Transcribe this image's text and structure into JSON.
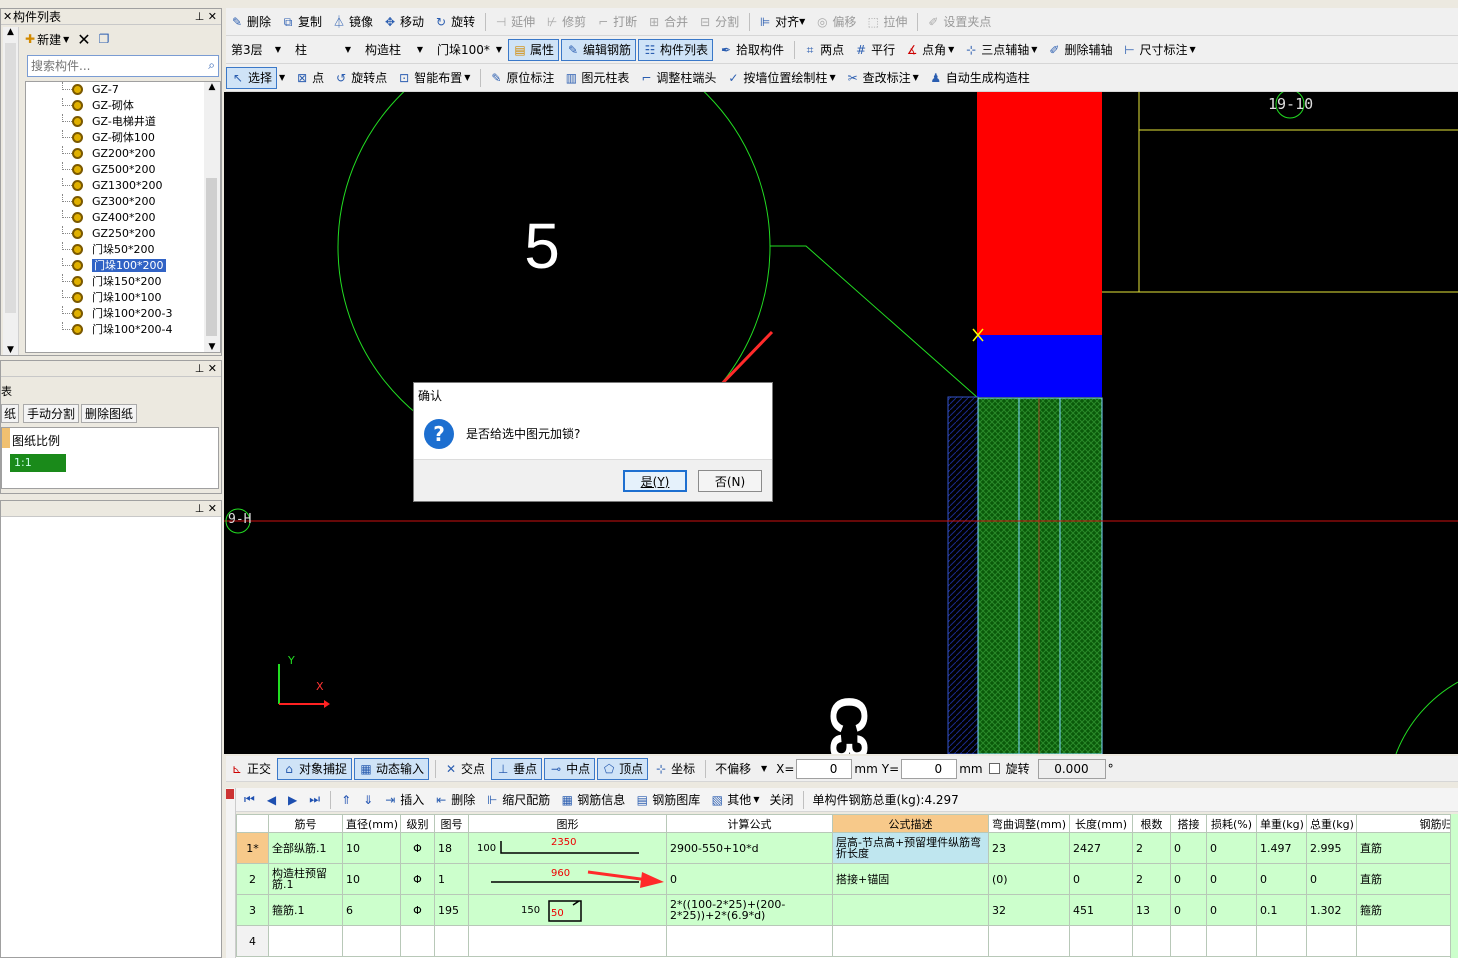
{
  "left_panel": {
    "title": "构件列表",
    "new_label": "新建",
    "search_placeholder": "搜索构件...",
    "items": [
      "GZ-7",
      "GZ-砌体",
      "GZ-电梯井道",
      "GZ-砌体100",
      "GZ200*200",
      "GZ500*200",
      "GZ1300*200",
      "GZ300*200",
      "GZ400*200",
      "GZ250*200",
      "门垛50*200",
      "门垛100*200",
      "门垛150*200",
      "门垛100*100",
      "门垛100*200-3",
      "门垛100*200-4"
    ],
    "selected_index": 11
  },
  "drawing_panel": {
    "title_fragment": "表",
    "tab_fragment": "纸",
    "split_label": "手动分割",
    "delete_label": "删除图纸",
    "scale_header": "图纸比例",
    "scale_value": "1:1"
  },
  "toolbar1": {
    "delete": "删除",
    "copy": "复制",
    "mirror": "镜像",
    "move": "移动",
    "rotate": "旋转",
    "extend": "延伸",
    "trim": "修剪",
    "break": "打断",
    "merge": "合并",
    "split": "分割",
    "align": "对齐",
    "offset": "偏移",
    "stretch": "拉伸",
    "set_grip": "设置夹点"
  },
  "toolbar2": {
    "floor": "第3层",
    "category": "柱",
    "type": "构造柱",
    "component": "门垛100*",
    "props": "属性",
    "edit_rebar": "编辑钢筋",
    "comp_list": "构件列表",
    "pick": "拾取构件",
    "two_point": "两点",
    "parallel": "平行",
    "corner": "点角",
    "three_point": "三点辅轴",
    "del_aux": "删除辅轴",
    "dim": "尺寸标注"
  },
  "toolbar3": {
    "select": "选择",
    "point": "点",
    "rotate_point": "旋转点",
    "smart": "智能布置",
    "inplace": "原位标注",
    "table": "图元柱表",
    "adjust": "调整柱端头",
    "by_wall": "按墙位置绘制柱",
    "check": "查改标注",
    "auto": "自动生成构造柱"
  },
  "canvas": {
    "circle_label": "5",
    "axis_right": "19-10",
    "axis_left": "9-H",
    "vert_text": "C3",
    "axis_x": "X",
    "axis_y": "Y"
  },
  "dialog": {
    "title": "确认",
    "message": "是否给选中图元加锁?",
    "yes": "是(Y)",
    "no": "否(N)"
  },
  "statusbar": {
    "ortho": "正交",
    "snap": "对象捕捉",
    "dyn": "动态输入",
    "intersect": "交点",
    "perp": "垂点",
    "mid": "中点",
    "vertex": "顶点",
    "coord": "坐标",
    "nooffset": "不偏移",
    "x_label": "X=",
    "x_val": "0",
    "mm1": "mm",
    "y_label": "Y=",
    "y_val": "0",
    "mm2": "mm",
    "rotate": "旋转",
    "rot_val": "0.000",
    "deg": "°"
  },
  "rebar_toolbar": {
    "insert": "插入",
    "delete": "删除",
    "scale": "缩尺配筋",
    "info": "钢筋信息",
    "lib": "钢筋图库",
    "other": "其他",
    "close": "关闭",
    "total": "单构件钢筋总重(kg):4.297"
  },
  "rebar_table": {
    "headers": [
      "筋号",
      "直径(mm)",
      "级别",
      "图号",
      "图形",
      "计算公式",
      "公式描述",
      "弯曲调整(mm)",
      "长度(mm)",
      "根数",
      "搭接",
      "损耗(%)",
      "单重(kg)",
      "总重(kg)",
      "钢筋归类"
    ],
    "rows": [
      {
        "n": "1*",
        "name": "全部纵筋.1",
        "dia": "10",
        "grade": "Φ",
        "fig": "18",
        "shape_left": "100",
        "shape_val": "2350",
        "formula": "2900-550+10*d",
        "desc": "层高-节点高+预留埋件纵筋弯折长度",
        "bend": "23",
        "len": "2427",
        "count": "2",
        "lap": "0",
        "loss": "0",
        "unit": "1.497",
        "total": "2.995",
        "cat": "直筋"
      },
      {
        "n": "2",
        "name": "构造柱预留筋.1",
        "dia": "10",
        "grade": "Φ",
        "fig": "1",
        "shape_left": "",
        "shape_val": "960",
        "formula": "0",
        "desc": "搭接+锚固",
        "bend": "(0)",
        "len": "0",
        "count": "2",
        "lap": "0",
        "loss": "0",
        "unit": "0",
        "total": "0",
        "cat": "直筋"
      },
      {
        "n": "3",
        "name": "箍筋.1",
        "dia": "6",
        "grade": "Φ",
        "fig": "195",
        "shape_left": "150",
        "shape_val": "50",
        "formula": "2*((100-2*25)+(200-2*25))+2*(6.9*d)",
        "desc": "",
        "bend": "32",
        "len": "451",
        "count": "13",
        "lap": "0",
        "loss": "0",
        "unit": "0.1",
        "total": "1.302",
        "cat": "箍筋"
      },
      {
        "n": "4",
        "name": "",
        "dia": "",
        "grade": "",
        "fig": "",
        "shape_left": "",
        "shape_val": "",
        "formula": "",
        "desc": "",
        "bend": "",
        "len": "",
        "count": "",
        "lap": "",
        "loss": "",
        "unit": "",
        "total": "",
        "cat": ""
      }
    ]
  },
  "colors": {
    "canvas": "#000000",
    "accent": "#3163c5",
    "red": "#ff0000",
    "blue": "#0000ff",
    "green_hatch": "#0a5a0a",
    "row_green": "#ccffcc"
  }
}
